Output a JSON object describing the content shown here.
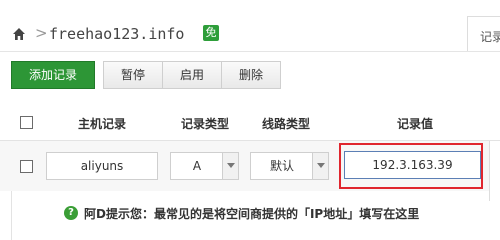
{
  "breadcrumb": {
    "separator": ">",
    "domain": "freehao123.info",
    "badge": "免"
  },
  "top_tab": {
    "label": "记录"
  },
  "toolbar": {
    "add_label": "添加记录",
    "pause_label": "暂停",
    "enable_label": "启用",
    "delete_label": "删除"
  },
  "table": {
    "headers": {
      "host": "主机记录",
      "type": "记录类型",
      "line": "线路类型",
      "value": "记录值"
    },
    "row": {
      "host": "aliyuns",
      "type": "A",
      "line": "默认",
      "value": "192.3.163.39"
    }
  },
  "tip": {
    "icon": "?",
    "text": "阿D提示您：最常见的是将空间商提供的「IP地址」填写在这里"
  },
  "colors": {
    "primary_green": "#2d9636",
    "highlight_red": "#e0262e"
  }
}
